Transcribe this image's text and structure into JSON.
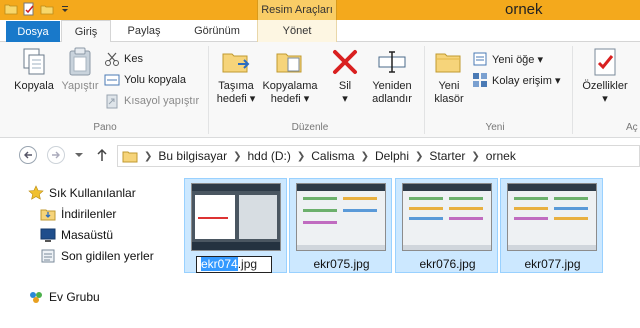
{
  "window": {
    "title": "ornek",
    "context_tab_group": "Resim Araçları"
  },
  "tabs": {
    "file": "Dosya",
    "home": "Giriş",
    "share": "Paylaş",
    "view": "Görünüm",
    "manage": "Yönet"
  },
  "ribbon": {
    "pano": {
      "label": "Pano",
      "copy": "Kopyala",
      "paste": "Yapıştır",
      "cut": "Kes",
      "copy_path": "Yolu kopyala",
      "paste_shortcut": "Kısayol yapıştır"
    },
    "duzenle": {
      "label": "Düzenle",
      "move_to_1": "Taşıma",
      "move_to_2": "hedefi ▾",
      "copy_to_1": "Kopyalama",
      "copy_to_2": "hedefi ▾",
      "delete_1": "Sil",
      "delete_2": "▾",
      "rename_1": "Yeniden",
      "rename_2": "adlandır"
    },
    "yeni": {
      "label": "Yeni",
      "new_folder_1": "Yeni",
      "new_folder_2": "klasör",
      "new_item": "Yeni öğe ▾",
      "easy_access": "Kolay erişim ▾"
    },
    "ac": {
      "label": "Aç",
      "properties_1": "Özellikler",
      "properties_2": "▾"
    }
  },
  "address": {
    "crumbs": [
      "Bu bilgisayar",
      "hdd (D:)",
      "Calisma",
      "Delphi",
      "Starter",
      "ornek"
    ]
  },
  "navpane": {
    "favorites": "Sık Kullanılanlar",
    "downloads": "İndirilenler",
    "desktop": "Masaüstü",
    "recent": "Son gidilen yerler",
    "homegroup": "Ev Grubu"
  },
  "files": [
    {
      "name": "ekr074.jpg",
      "rename_selected": "ekr074",
      "rename_rest": ".jpg"
    },
    {
      "name": "ekr075.jpg"
    },
    {
      "name": "ekr076.jpg"
    },
    {
      "name": "ekr077.jpg"
    }
  ],
  "colors": {
    "titlebar": "#f4a91c",
    "file_tab": "#1979ca",
    "selection": "#cce8ff",
    "selection_border": "#99d1ff",
    "text_selection": "#3399ff"
  }
}
